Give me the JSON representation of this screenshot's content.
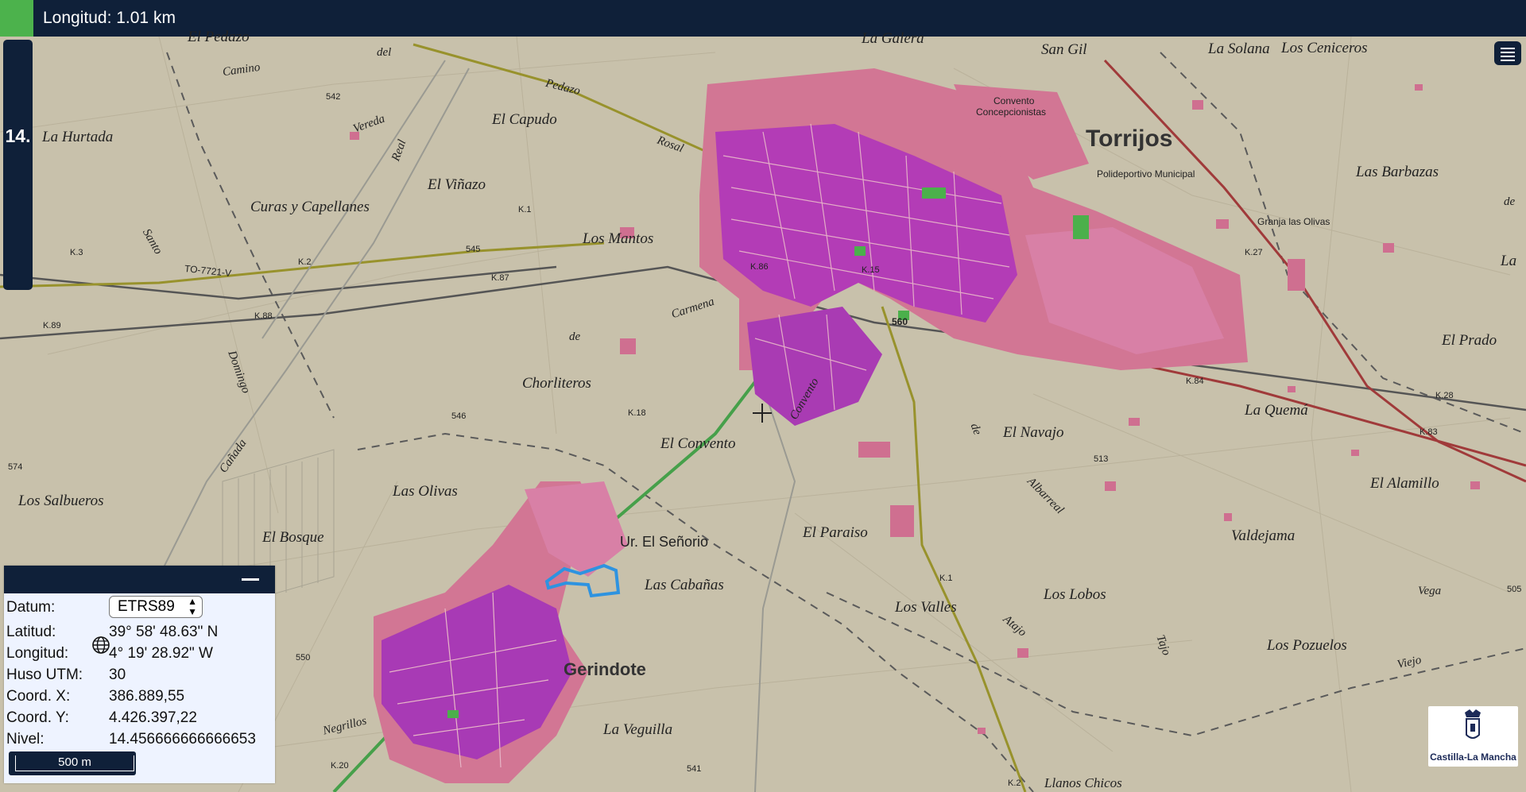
{
  "topbar": {
    "title": "Longitud: 1.01 km",
    "accent_color": "#4cb24c",
    "bg_color": "#0f2039"
  },
  "zoom": {
    "label": "14."
  },
  "layers_button": {
    "icon": "layers-icon"
  },
  "coords_panel": {
    "datum_label": "Datum:",
    "datum_value": "ETRS89",
    "lat_label": "Latitud:",
    "lat_value": "39° 58' 48.63\" N",
    "lon_label": "Longitud:",
    "lon_value": "4° 19' 28.92\" W",
    "huso_label": "Huso UTM:",
    "huso_value": "30",
    "x_label": "Coord. X:",
    "x_value": "386.889,55",
    "y_label": "Coord. Y:",
    "y_value": "4.426.397,22",
    "nivel_label": "Nivel:",
    "nivel_value": "14.456666666666653",
    "scale_label": "500 m"
  },
  "logo": {
    "name": "Castilla-La Mancha"
  },
  "map_labels": {
    "torrijos": "Torrijos",
    "gerindote": "Gerindote",
    "la_hurtada": "La Hurtada",
    "el_capudo": "El Capudo",
    "el_vinazo": "El Viñazo",
    "curas": "Curas y Capellanes",
    "los_mantos": "Los Mantos",
    "chorliteros": "Chorliteros",
    "el_convento": "El Convento",
    "las_olivas": "Las Olivas",
    "los_salbueros": "Los Salbueros",
    "el_bosque": "El Bosque",
    "el_senorio": "Ur. El Señorio",
    "las_cabanas": "Las Cabañas",
    "el_paraiso": "El Paraiso",
    "los_valles": "Los Valles",
    "la_veguilla": "La Veguilla",
    "el_navajo": "El Navajo",
    "la_quema": "La Quemá",
    "el_alamillo": "El Alamillo",
    "valdejama": "Valdejama",
    "los_lobos": "Los Lobos",
    "los_pozuelos": "Los Pozuelos",
    "las_barbazas": "Las Barbazas",
    "el_prado": "El Prado",
    "la_solana": "La Solana",
    "los_ceniceros": "Los Ceniceros",
    "san_gil": "San Gil",
    "la_galera": "La Galera",
    "el_pedazo": "El Pedazo",
    "convento": "Convento",
    "concepcionistas": "Concepcionistas",
    "polideportivo": "Polideportivo Municipal",
    "granja": "Granja las Olivas",
    "to7721": "TO-7721-V",
    "camino": "Camino",
    "vereda": "Vereda",
    "real": "Real",
    "carmena": "Carmena",
    "santo": "Santo",
    "domingo": "Domingo",
    "canada": "Cañada",
    "albarreal": "Albarreal",
    "vega": "Vega",
    "viejo": "Viejo",
    "negrillos": "Negrillos",
    "convento_road": "Convento",
    "atajo": "Atajo",
    "tajo": "Tajo",
    "rosal": "Rosal",
    "del": "del",
    "pedazo": "Pedazo",
    "de": "de",
    "de2": "de",
    "de3": "de",
    "k1": "K.1",
    "k2": "K.2",
    "k3": "K.3",
    "k86": "K.86",
    "k87": "K.87",
    "k88": "K.88",
    "k89": "K.89",
    "k18": "K.18",
    "k20": "K.20",
    "k27": "K.27",
    "k28": "K.28",
    "k84": "K.84",
    "k83": "K.83",
    "k15": "K.15",
    "k1b": "K.1",
    "k2b": "K.2",
    "e542": "542",
    "e545": "545",
    "e546": "546",
    "e574": "574",
    "e560": "560",
    "e513": "513",
    "e505": "505",
    "e541": "541",
    "e550": "550",
    "lla": "La",
    "llanos": "Llanos Chicos"
  }
}
